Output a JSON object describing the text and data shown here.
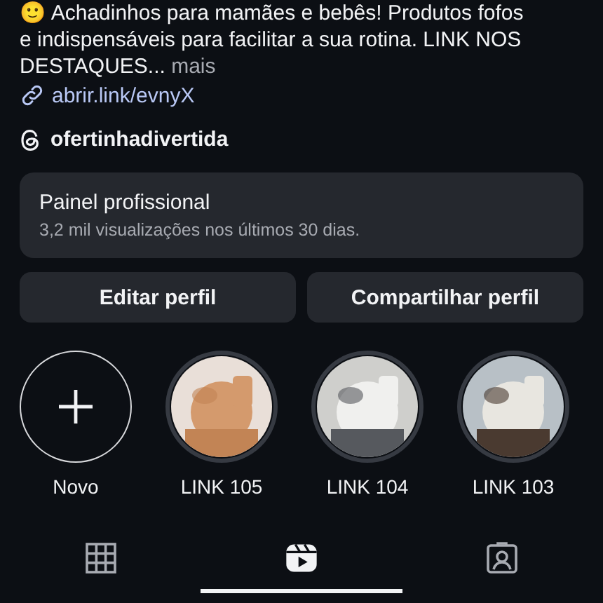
{
  "bio": {
    "lines": [
      "🙂 Achadinhos para mamães e bebês! Produtos fofos",
      "e indispensáveis para facilitar a sua rotina. LINK NOS"
    ],
    "last_line": "DESTAQUES...",
    "more": "mais"
  },
  "link": "abrir.link/evnyX",
  "threads_handle": "ofertinhadivertida",
  "dashboard": {
    "title": "Painel profissional",
    "subtitle": "3,2 mil visualizações nos últimos 30 dias."
  },
  "buttons": [
    "Editar perfil",
    "Compartilhar perfil"
  ],
  "highlights": [
    {
      "kind": "new",
      "label": "Novo"
    },
    {
      "kind": "story",
      "label": "LINK 105"
    },
    {
      "kind": "story",
      "label": "LINK 104"
    },
    {
      "kind": "story",
      "label": "LINK 103"
    }
  ],
  "tabs": [
    {
      "kind": "grid",
      "selected": false
    },
    {
      "kind": "reels",
      "selected": true
    },
    {
      "kind": "tagged",
      "selected": false
    }
  ]
}
